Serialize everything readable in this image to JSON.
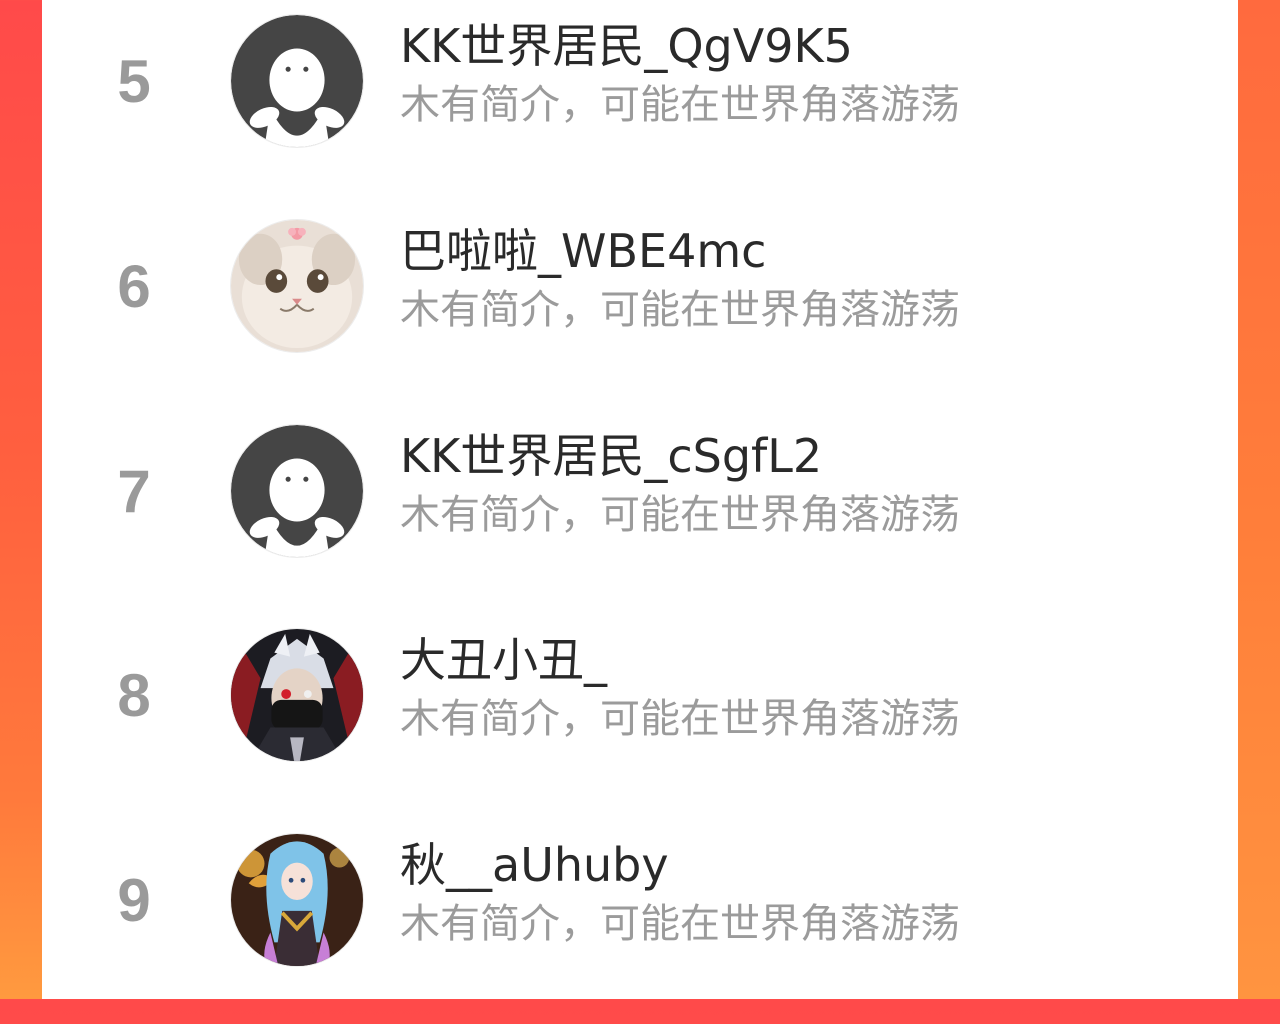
{
  "users": [
    {
      "rank": "5",
      "name": "KK世界居民_QgV9K5",
      "bio": "木有简介，可能在世界角落游荡",
      "avatar_icon": "default-ghost-avatar-icon"
    },
    {
      "rank": "6",
      "name": "巴啦啦_WBE4mc",
      "bio": "木有简介，可能在世界角落游荡",
      "avatar_icon": "cat-avatar-icon"
    },
    {
      "rank": "7",
      "name": "KK世界居民_cSgfL2",
      "bio": "木有简介，可能在世界角落游荡",
      "avatar_icon": "default-ghost-avatar-icon"
    },
    {
      "rank": "8",
      "name": "大丑小丑_",
      "bio": "木有简介，可能在世界角落游荡",
      "avatar_icon": "masked-character-avatar-icon"
    },
    {
      "rank": "9",
      "name": "秋__aUhuby",
      "bio": "木有简介，可能在世界角落游荡",
      "avatar_icon": "anime-girl-avatar-icon"
    }
  ],
  "colors": {
    "background_gradient_start": "#ff4a4a",
    "background_gradient_end": "#ff9a3f",
    "rank_gray": "#9a9a9a",
    "name_text": "#2a2a2a",
    "bio_text": "#9b9b9b"
  }
}
